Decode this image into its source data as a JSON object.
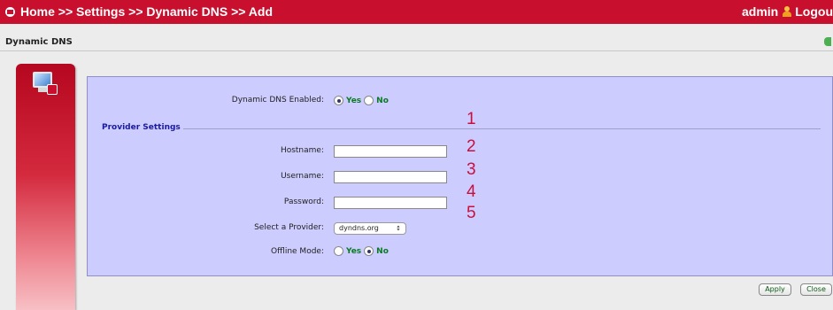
{
  "header": {
    "breadcrumb": "Home >> Settings >> Dynamic DNS >> Add",
    "user": "admin",
    "logout": "Logou"
  },
  "page": {
    "title": "Dynamic DNS"
  },
  "form": {
    "ddns_enabled_label": "Dynamic DNS Enabled:",
    "ddns_enabled_value": "Yes",
    "yes": "Yes",
    "no": "No",
    "section_title": "Provider Settings",
    "hostname_label": "Hostname:",
    "username_label": "Username:",
    "password_label": "Password:",
    "provider_label": "Select a Provider:",
    "provider_value": "dyndns.org",
    "offline_label": "Offline Mode:",
    "offline_value": "No"
  },
  "annotations": [
    "1",
    "2",
    "3",
    "4",
    "5"
  ],
  "buttons": {
    "apply": "Apply",
    "close": "Close"
  },
  "colors": {
    "brand_red": "#c8102e",
    "panel_bg": "#ccccff",
    "yes_no_green": "#0a7a22",
    "annotation_red": "#c8103e"
  }
}
